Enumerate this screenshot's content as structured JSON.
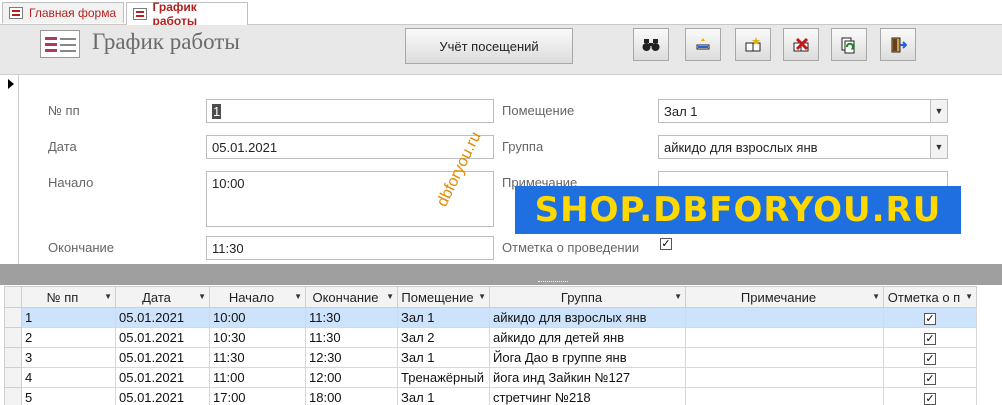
{
  "tabs": [
    {
      "label": "Главная форма",
      "active": false
    },
    {
      "label": "График работы",
      "active": true
    }
  ],
  "header": {
    "title": "График работы",
    "visits_button": "Учёт посещений",
    "toolbar_icons": [
      "binoculars-icon",
      "edit-record-icon",
      "add-record-icon",
      "delete-record-icon",
      "refresh-icon",
      "exit-icon"
    ]
  },
  "detail": {
    "num_label": "№ пп",
    "num_value": "1",
    "date_label": "Дата",
    "date_value": "05.01.2021",
    "start_label": "Начало",
    "start_value": "10:00",
    "end_label": "Окончание",
    "end_value": "11:30",
    "room_label": "Помещение",
    "room_value": "Зал 1",
    "group_label": "Группа",
    "group_value": "айкидо для взрослых янв",
    "note_label": "Примечание",
    "note_value": "",
    "held_label": "Отметка о проведении",
    "held_checked": true
  },
  "watermark": {
    "diagonal": "dbforyou.ru",
    "banner": "SHOP.DBFORYOU.RU"
  },
  "table": {
    "columns": [
      "№ пп",
      "Дата",
      "Начало",
      "Окончание",
      "Помещение",
      "Группа",
      "Примечание",
      "Отметка о п"
    ],
    "rows": [
      {
        "num": "1",
        "date": "05.01.2021",
        "start": "10:00",
        "end": "11:30",
        "room": "Зал 1",
        "group": "айкидо для взрослых янв",
        "note": "",
        "held": true
      },
      {
        "num": "2",
        "date": "05.01.2021",
        "start": "10:30",
        "end": "11:30",
        "room": "Зал 2",
        "group": "айкидо для детей янв",
        "note": "",
        "held": true
      },
      {
        "num": "3",
        "date": "05.01.2021",
        "start": "11:30",
        "end": "12:30",
        "room": "Зал 1",
        "group": "Йога Дао в группе янв",
        "note": "",
        "held": true
      },
      {
        "num": "4",
        "date": "05.01.2021",
        "start": "11:00",
        "end": "12:00",
        "room": "Тренажёрный",
        "group": "йога инд Зайкин №127",
        "note": "",
        "held": true
      },
      {
        "num": "5",
        "date": "05.01.2021",
        "start": "17:00",
        "end": "18:00",
        "room": "Зал 1",
        "group": "стретчинг №218",
        "note": "",
        "held": true
      }
    ]
  },
  "colors": {
    "tab_text": "#b22222",
    "selected_row": "#cde3fb",
    "banner_bg": "#1f6fe0",
    "banner_text": "#ffd800",
    "diagonal_text": "#e08a00"
  }
}
